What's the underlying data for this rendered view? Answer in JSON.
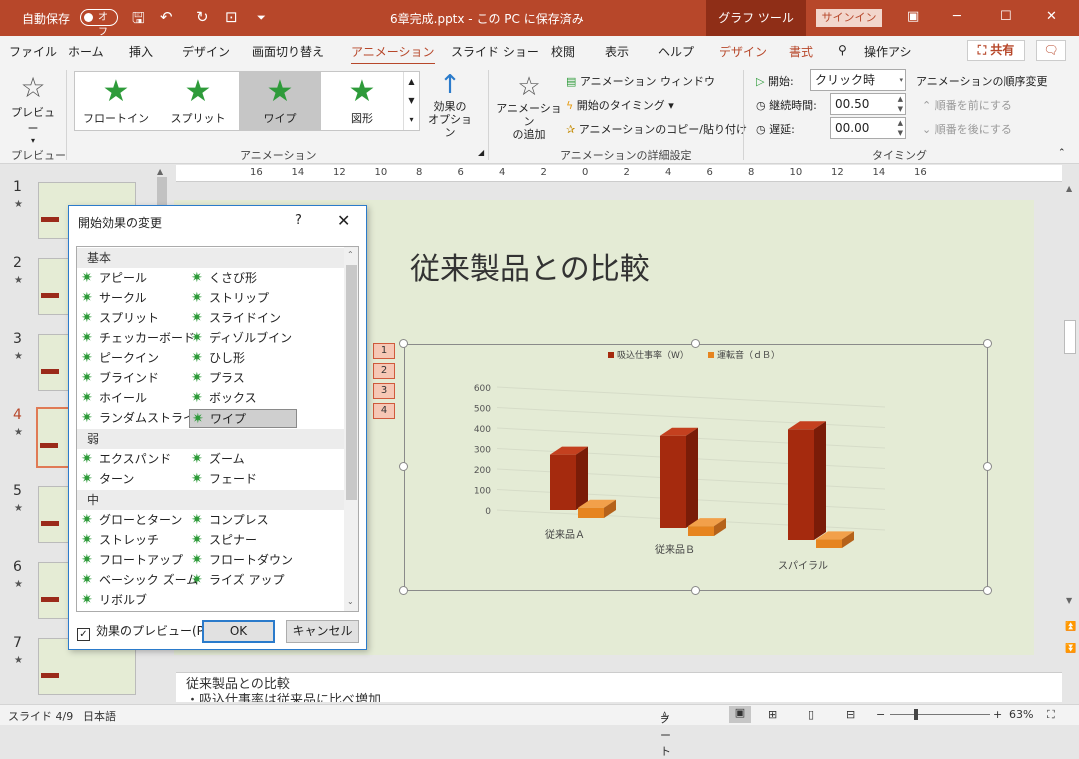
{
  "titlebar": {
    "autosave_label": "自動保存",
    "autosave_state": "オフ",
    "doc_title": "6章完成.pptx - この PC に保存済み",
    "context_tab": "グラフ ツール",
    "signin": "サインイン"
  },
  "tabs": [
    "ファイル",
    "ホーム",
    "挿入",
    "デザイン",
    "画面切り替え",
    "アニメーション",
    "スライド ショー",
    "校閲",
    "表示",
    "ヘルプ",
    "デザイン",
    "書式"
  ],
  "active_tab": "アニメーション",
  "tell_me": "操作アシ",
  "share_label": "共有",
  "ribbon": {
    "preview_label": "プレビュー",
    "preview_group": "プレビュー",
    "gallery": [
      "フロートイン",
      "スプリット",
      "ワイプ",
      "図形"
    ],
    "gallery_selected": "ワイプ",
    "effect_options": "効果の\nオプション",
    "animation_group": "アニメーション",
    "add_animation": "アニメーション\nの追加",
    "animation_pane": "アニメーション ウィンドウ",
    "trigger": "開始のタイミング",
    "painter": "アニメーションのコピー/貼り付け",
    "advanced_group": "アニメーションの詳細設定",
    "start_label": "開始:",
    "start_value": "クリック時",
    "duration_label": "継続時間:",
    "duration_value": "00.50",
    "delay_label": "遅延:",
    "delay_value": "00.00",
    "reorder_title": "アニメーションの順序変更",
    "move_earlier": "順番を前にする",
    "move_later": "順番を後にする",
    "timing_group": "タイミング"
  },
  "ruler_ticks": [
    "16",
    "14",
    "12",
    "10",
    "8",
    "6",
    "4",
    "2",
    "0",
    "2",
    "4",
    "6",
    "8",
    "10",
    "12",
    "14",
    "16"
  ],
  "thumbnails": [
    {
      "num": "1",
      "star": "★"
    },
    {
      "num": "2",
      "star": "★"
    },
    {
      "num": "3",
      "star": "★"
    },
    {
      "num": "4",
      "star": "★"
    },
    {
      "num": "5",
      "star": "★"
    },
    {
      "num": "6",
      "star": "★"
    },
    {
      "num": "7",
      "star": "★"
    }
  ],
  "current_slide": "4",
  "slide": {
    "title": "従来製品との比較",
    "anim_tags": [
      "1",
      "2",
      "3",
      "4"
    ]
  },
  "chart_data": {
    "type": "bar",
    "categories": [
      "従来品Ａ",
      "従来品Ｂ",
      "スパイラル"
    ],
    "series": [
      {
        "name": "吸込仕事率（W）",
        "values": [
          270,
          450,
          540
        ],
        "color": "#a52a0e"
      },
      {
        "name": "運転音（ｄＢ）",
        "values": [
          50,
          48,
          42
        ],
        "color": "#e6841f"
      }
    ],
    "ylim": [
      0,
      600
    ],
    "yticks": [
      "600",
      "500",
      "400",
      "300",
      "200",
      "100",
      "0"
    ],
    "legend": "top"
  },
  "notes": {
    "line1": "従来製品との比較",
    "line2": "・吸込仕事率は従来品に比べ増加"
  },
  "status": {
    "slide_info": "スライド 4/9",
    "language": "日本語",
    "notes_btn": "ノート",
    "zoom": "63%"
  },
  "dialog": {
    "title": "開始効果の変更",
    "help": "?",
    "categories": {
      "basic": "基本",
      "subtle": "弱",
      "moderate": "中"
    },
    "basic_left": [
      "アピール",
      "サークル",
      "スプリット",
      "チェッカーボード",
      "ピークイン",
      "ブラインド",
      "ホイール",
      "ランダムストライプ"
    ],
    "basic_right": [
      "くさび形",
      "ストリップ",
      "スライドイン",
      "ディゾルブイン",
      "ひし形",
      "プラス",
      "ボックス",
      "ワイプ"
    ],
    "subtle_left": [
      "エクスパンド",
      "ターン"
    ],
    "subtle_right": [
      "ズーム",
      "フェード"
    ],
    "moderate_left": [
      "グローとターン",
      "ストレッチ",
      "フロートアップ",
      "ベーシック ズーム",
      "リボルブ"
    ],
    "moderate_right": [
      "コンプレス",
      "スピナー",
      "フロートダウン",
      "ライズ アップ"
    ],
    "selected": "ワイプ",
    "preview_checkbox": "効果のプレビュー(P)",
    "ok": "OK",
    "cancel": "キャンセル"
  }
}
